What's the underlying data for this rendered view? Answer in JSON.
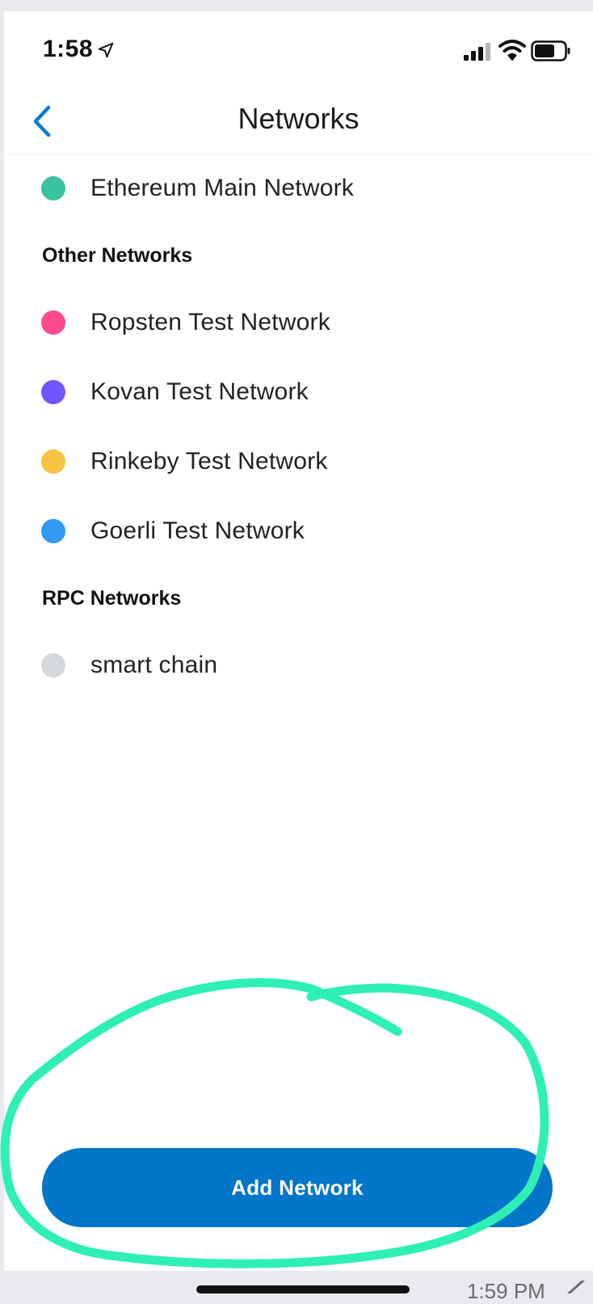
{
  "status_bar": {
    "time": "1:58",
    "icons": [
      "location-arrow-icon",
      "cellular-signal-icon",
      "wifi-icon",
      "battery-icon"
    ]
  },
  "nav": {
    "back_icon": "chevron-left-icon",
    "title": "Networks"
  },
  "main_network": {
    "name": "Ethereum Main Network",
    "color": "#3cc29e"
  },
  "other_networks": {
    "header": "Other Networks",
    "items": [
      {
        "name": "Ropsten Test Network",
        "color": "#ff4a8d"
      },
      {
        "name": "Kovan Test Network",
        "color": "#7057ff"
      },
      {
        "name": "Rinkeby Test Network",
        "color": "#f6c343"
      },
      {
        "name": "Goerli Test Network",
        "color": "#3099f2"
      }
    ]
  },
  "rpc_networks": {
    "header": "RPC Networks",
    "items": [
      {
        "name": "smart chain",
        "color": "#d6d9dc"
      }
    ]
  },
  "add_button": {
    "label": "Add Network",
    "color": "#0376c9"
  },
  "annotation": {
    "color": "#2ef0b4"
  },
  "bottom": {
    "time": "1:59 PM"
  },
  "colors": {
    "accent": "#037dd6"
  }
}
